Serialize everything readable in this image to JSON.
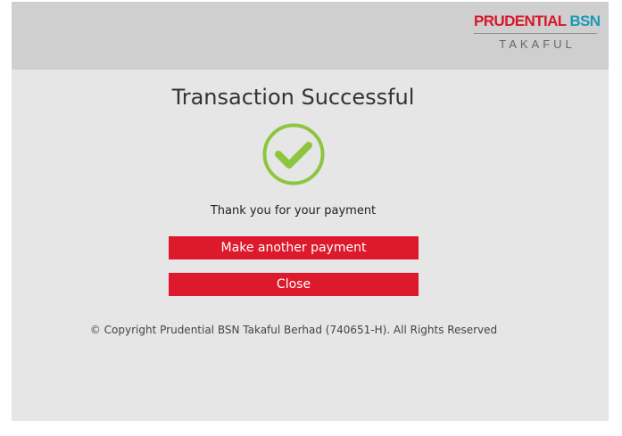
{
  "logo": {
    "brand_red": "PRUDENTIAL",
    "brand_teal": "BSN",
    "subtitle": "TAKAFUL"
  },
  "main": {
    "title": "Transaction Successful",
    "status_icon": "check-circle-icon",
    "message": "Thank you for your payment",
    "another_payment_label": "Make another payment",
    "close_label": "Close"
  },
  "footer": {
    "copyright": "© Copyright Prudential BSN Takaful Berhad (740651-H). All Rights Reserved"
  },
  "colors": {
    "header_bg": "#cfcfcf",
    "page_bg": "#e6e6e6",
    "button_red": "#dc1a2b",
    "check_green": "#8cc63f",
    "brand_red": "#d7182a",
    "brand_teal": "#1b9bb5"
  }
}
